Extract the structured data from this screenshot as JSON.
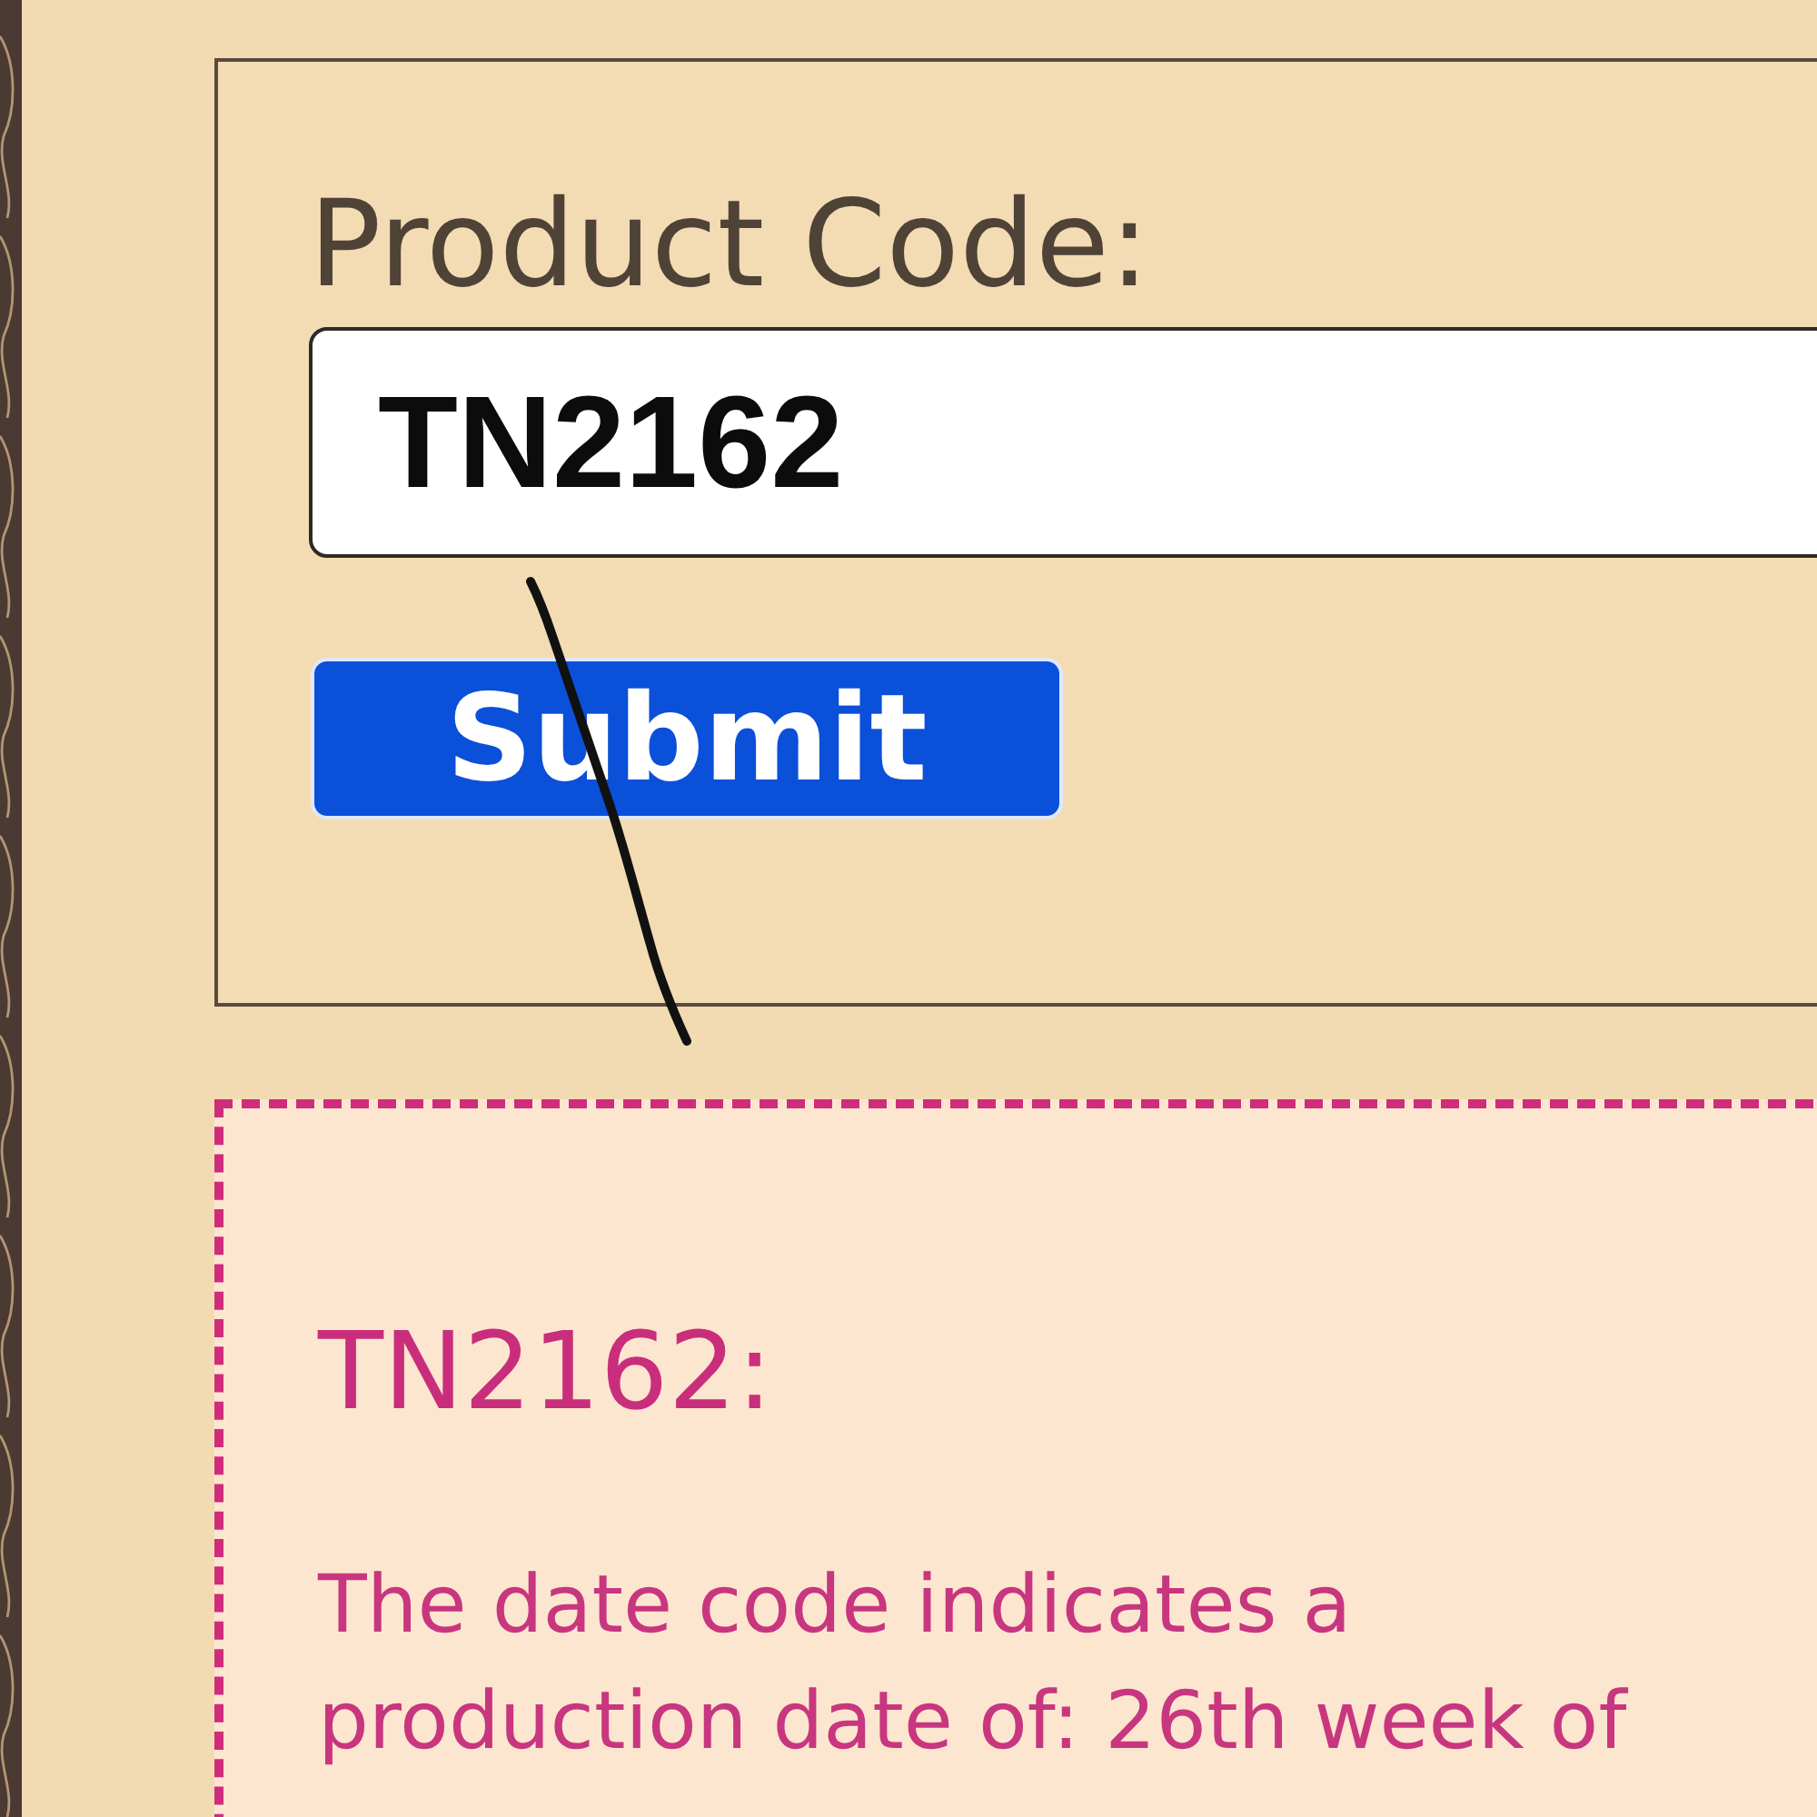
{
  "form": {
    "label": "Product Code:",
    "input": {
      "value": "TN2162"
    },
    "button": {
      "label": "Submit"
    }
  },
  "result": {
    "title": "TN2162:",
    "text": "The date code indicates a production date of: 26th week of"
  }
}
